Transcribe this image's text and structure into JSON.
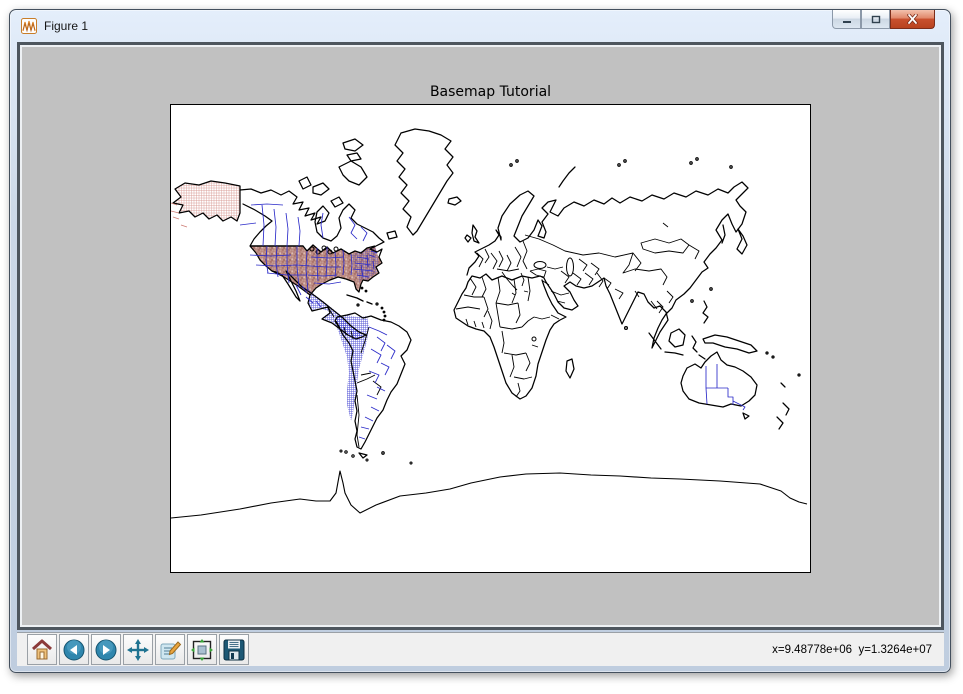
{
  "window": {
    "title": "Figure 1",
    "app_icon": "matplotlib-icon",
    "controls": [
      {
        "id": "minimize",
        "icon": "minimize-icon"
      },
      {
        "id": "maximize",
        "icon": "maximize-icon"
      },
      {
        "id": "close",
        "icon": "close-icon"
      }
    ]
  },
  "figure": {
    "title": "Basemap Tutorial"
  },
  "toolbar": {
    "buttons": [
      {
        "id": "home",
        "icon": "home-icon"
      },
      {
        "id": "back",
        "icon": "back-icon"
      },
      {
        "id": "forward",
        "icon": "forward-icon"
      },
      {
        "id": "pan",
        "icon": "pan-icon"
      },
      {
        "id": "edit-parameters",
        "icon": "edit-parameters-icon"
      },
      {
        "id": "configure-subplots",
        "icon": "configure-subplots-icon"
      },
      {
        "id": "save",
        "icon": "save-icon"
      }
    ]
  },
  "statusbar": {
    "coordinates": "x=9.48778e+06  y=1.3264e+07"
  },
  "map": {
    "colors": {
      "coastline": "#000000",
      "admin_border_blue": "#2a2ac8",
      "county_line_red": "#cc7b73",
      "us_county_fill": "#bd8e84",
      "canvas_background": "#c1c1c1",
      "map_background": "#ffffff"
    }
  }
}
